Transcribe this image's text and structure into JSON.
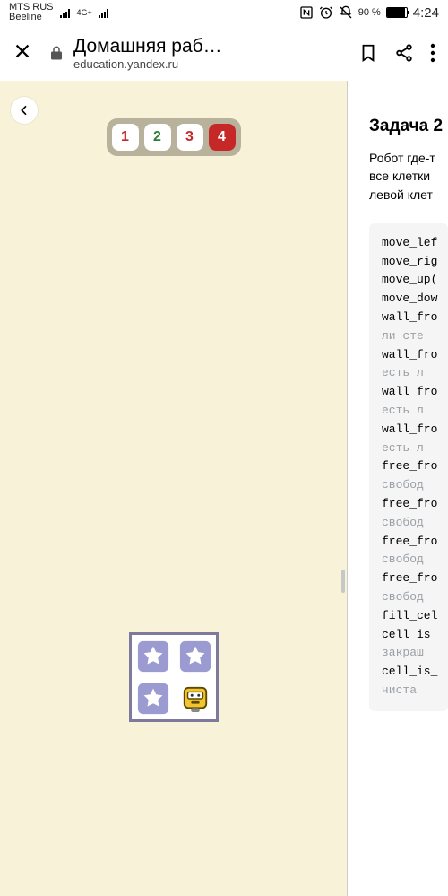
{
  "statusbar": {
    "carrier1": "MTS RUS",
    "carrier2": "Beeline",
    "net_badge": "4G+",
    "battery_pct": "90 %",
    "battery_level": 90,
    "clock": "4:24"
  },
  "urlbar": {
    "page_title": "Домашняя рабо…",
    "host": "education.yandex.ru"
  },
  "game": {
    "levels": [
      "1",
      "2",
      "3",
      "4"
    ],
    "active_level_index": 3
  },
  "task": {
    "heading": "Задача 2",
    "desc_l1": "Робот где-т",
    "desc_l2": "все клетки",
    "desc_l3": "левой клет",
    "code_lines": [
      {
        "t": "move_lef"
      },
      {
        "t": "move_rig"
      },
      {
        "t": "move_up("
      },
      {
        "t": "move_dow"
      },
      {
        "t": "wall_fro"
      },
      {
        "t": " ли сте",
        "c": true
      },
      {
        "t": "wall_fro"
      },
      {
        "t": " есть л",
        "c": true
      },
      {
        "t": "wall_fro"
      },
      {
        "t": " есть л",
        "c": true
      },
      {
        "t": "wall_fro"
      },
      {
        "t": " есть л",
        "c": true
      },
      {
        "t": "free_fro"
      },
      {
        "t": " свобод",
        "c": true
      },
      {
        "t": "free_fro"
      },
      {
        "t": " свобод",
        "c": true
      },
      {
        "t": "free_fro"
      },
      {
        "t": " свобод",
        "c": true
      },
      {
        "t": "free_fro"
      },
      {
        "t": " свобод",
        "c": true
      },
      {
        "t": "fill_cel"
      },
      {
        "t": "cell_is_"
      },
      {
        "t": " закраш",
        "c": true
      },
      {
        "t": "cell_is_"
      },
      {
        "t": " чиста ",
        "c": true
      }
    ]
  }
}
